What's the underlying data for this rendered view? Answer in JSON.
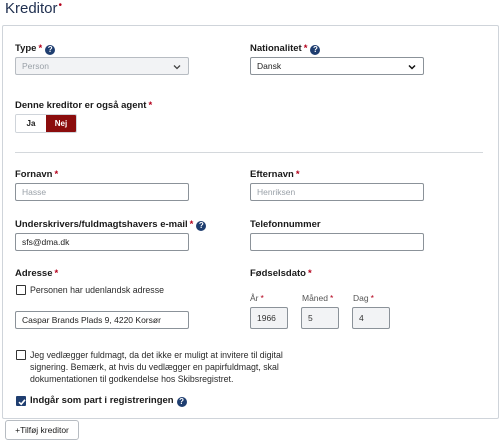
{
  "title": "Kreditor",
  "required_marker": "•",
  "type": {
    "label": "Type",
    "value": "Person"
  },
  "nationalitet": {
    "label": "Nationalitet",
    "value": "Dansk"
  },
  "agent": {
    "label": "Denne kreditor er også agent",
    "options": [
      "Ja",
      "Nej"
    ],
    "selected": "Nej"
  },
  "fornavn": {
    "label": "Fornavn",
    "value": "Hasse"
  },
  "efternavn": {
    "label": "Efternavn",
    "value": "Henriksen"
  },
  "email": {
    "label": "Underskrivers/fuldmagtshavers e-mail",
    "value": "sfs@dma.dk"
  },
  "telefon": {
    "label": "Telefonnummer",
    "value": ""
  },
  "adresse": {
    "label": "Adresse",
    "foreign_checkbox_label": "Personen har udenlandsk adresse",
    "foreign_checked": false,
    "value": "Caspar Brands Plads 9, 4220 Korsør"
  },
  "foedselsdato": {
    "label": "Fødselsdato",
    "year_label": "År",
    "month_label": "Måned",
    "day_label": "Dag",
    "year": "1966",
    "month": "5",
    "day": "4"
  },
  "fuldmagt": {
    "checked": false,
    "line1": "Jeg vedlægger fuldmagt, da det ikke er muligt at invitere til digital",
    "line2": "signering. Bemærk, at hvis du vedlægger en papirfuldmagt, skal",
    "line3": "dokumentationen til godkendelse hos Skibsregistret."
  },
  "indgaar": {
    "checked": true,
    "label": "Indgår som part i registreringen"
  },
  "add_button": "+Tilføj kreditor",
  "colors": {
    "accent_red": "#8b0d0d",
    "help_blue": "#1f3e70",
    "title_blue": "#1f2f4f"
  }
}
